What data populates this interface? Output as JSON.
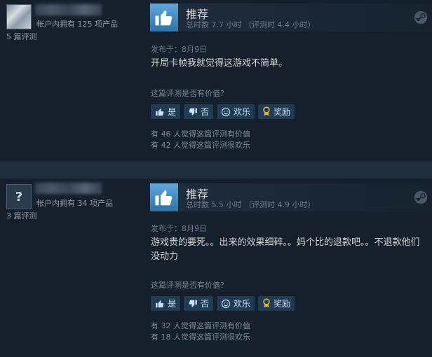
{
  "reviews": [
    {
      "avatar_glyph": "",
      "owned": "帐户内拥有 125 项产品",
      "review_count": "5 篇评测",
      "verdict": "推荐",
      "hours": "总时数 7.7 小时 （评测时 4.4 小时）",
      "posted": "发布于：8月9日",
      "text": "开局卡帧我就觉得这游戏不简单。",
      "helpful_question": "这篇评测是否有价值?",
      "buttons": {
        "yes": "是",
        "no": "否",
        "funny": "欢乐",
        "award": "奖励"
      },
      "helpful_count": "有 46 人觉得这篇评测有价值",
      "funny_count": "有 42 人觉得这篇评测很欢乐"
    },
    {
      "avatar_glyph": "?",
      "owned": "帐户内拥有 34 项产品",
      "review_count": "3 篇评测",
      "verdict": "推荐",
      "hours": "总时数 5.5 小时 （评测时 4.9 小时）",
      "posted": "发布于：8月9日",
      "text": "游戏贵的要死。。出来的效果细碎。。妈个比的退款吧。。不退款他们没动力",
      "helpful_question": "这篇评测是否有价值?",
      "buttons": {
        "yes": "是",
        "no": "否",
        "funny": "欢乐",
        "award": "奖励"
      },
      "helpful_count": "有 32 人觉得这篇评测有价值",
      "funny_count": "有 18 人觉得这篇评测很欢乐"
    }
  ],
  "colors": {
    "background": "#1b2838",
    "review_bg": "#16202d",
    "button_bg": "#1f3b55",
    "thumb_blue": "#5ea8dd",
    "award_gold": "#e8b53a"
  },
  "icons": {
    "verdict": "thumbs-up-icon",
    "yes": "thumbs-up-icon",
    "no": "thumbs-down-icon",
    "funny": "smiley-icon",
    "award": "award-medal-icon",
    "platform": "steam-icon"
  }
}
